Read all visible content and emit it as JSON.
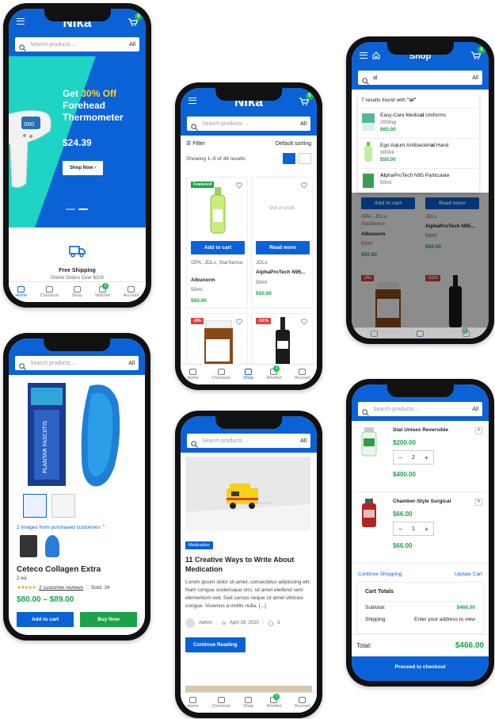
{
  "colors": {
    "primary": "#0b62d6",
    "accent_green": "#1aa34a",
    "teal": "#1ed4c4",
    "sale_red": "#e43f3f",
    "hero_highlight": "#ffd22b"
  },
  "common": {
    "logo": "Nika",
    "search_placeholder": "Search products ...",
    "search_scope": "All",
    "cart_count": "0",
    "wishlist_count": "0",
    "nav": {
      "home": "Home",
      "checkout": "Checkout",
      "shop": "Shop",
      "wishlist": "Wishlist",
      "account": "Account"
    }
  },
  "phone1": {
    "hero_title_prefix": "Get ",
    "hero_title_highlight": "30% Off",
    "hero_title_rest": "Forehead Thermometer",
    "hero_price": "$24.39",
    "hero_button": "Shop Now",
    "feature_title": "Free Shipping",
    "feature_sub": "Online Orders Over $200"
  },
  "phone2": {
    "filter": "Filter",
    "sorting": "Default sorting",
    "showing": "Showing 1–9 of 48 results",
    "products": [
      {
        "tag": "Featured",
        "button": "Add to cart",
        "cats": "GPA, JDLs, StarSence",
        "name": "Albunorm",
        "size": "50ml",
        "price": "$50.00"
      },
      {
        "overlay": "Out of stock",
        "button": "Read more",
        "cats": "JDLs",
        "name": "AlphaProTech N95...",
        "size": "50ml",
        "price": "$50.00"
      },
      {
        "tag": "-9%"
      },
      {
        "tag": "-51%"
      }
    ]
  },
  "phone3": {
    "title": "Shop",
    "search_value": "al",
    "results_prefix": "7 results found with ",
    "results_term": "\"al\"",
    "results": [
      {
        "name_a": "Easy-Care Medic",
        "name_b": "al",
        "name_c": " Uniforms",
        "size": "200mg",
        "price": "$65.00"
      },
      {
        "name_a": "Ego Aqium Antibacteri",
        "name_b": "al",
        "name_c": " Hand",
        "size": "300ml",
        "price": "$50.00"
      },
      {
        "name_a": "",
        "name_b": "Al",
        "name_c": "phaProTech N95 Particulate",
        "size": "50ml",
        "price": ""
      }
    ],
    "bg": {
      "add_to_cart": "Add to cart",
      "read_more": "Read more",
      "cats1": "GPA, JDLs, StarSence",
      "name1": "Albunorm",
      "size1": "50ml",
      "price1": "$50.00",
      "cats2": "JDLs",
      "name2": "AlphaProTech N95...",
      "size2": "50ml",
      "price2": "$50.00",
      "sale1": "-9%",
      "sale2": "-51%"
    }
  },
  "phone4": {
    "more_images": "2 Images from purchased customers",
    "title": "Ceteco Collagen Extra",
    "qty": "2 ea",
    "reviews": "2 customer reviews",
    "sold": "Sold: 34",
    "price_range": "$80.00 – $89.00",
    "add_to_cart": "Add to cart",
    "buy_now": "Buy Now",
    "insole_label": "PLANTAR FASCIITIS"
  },
  "phone5": {
    "category": "Medication",
    "title": "11 Creative Ways to Write About Medication",
    "excerpt": "Lorem ipsum dolor sit amet, consectetur adipiscing elit. Nam congue scelerisque orci, sit amet eleifend sem elementum sed. Sed cursus neque sit amet ultricies congue. Vivamus a mollis nulla, [...]",
    "author": "Admin",
    "date": "April 29, 2020",
    "comments": "3",
    "button": "Continue Reading"
  },
  "phone6": {
    "items": [
      {
        "name": "Stat Unisex Reversible",
        "unit": "$200.00",
        "qty": "2",
        "total": "$400.00"
      },
      {
        "name": "Chamber-Style Surgical",
        "unit": "$66.00",
        "qty": "1",
        "total": "$66.00"
      }
    ],
    "continue": "Continue Shopping",
    "update": "Update Cart",
    "totals_title": "Cart Totals",
    "subtotal_label": "Subtotal:",
    "subtotal": "$466.00",
    "shipping_label": "Shipping:",
    "shipping": "Enter your address to view",
    "total_label": "Total:",
    "total": "$466.00",
    "checkout": "Proceed to checkout"
  }
}
